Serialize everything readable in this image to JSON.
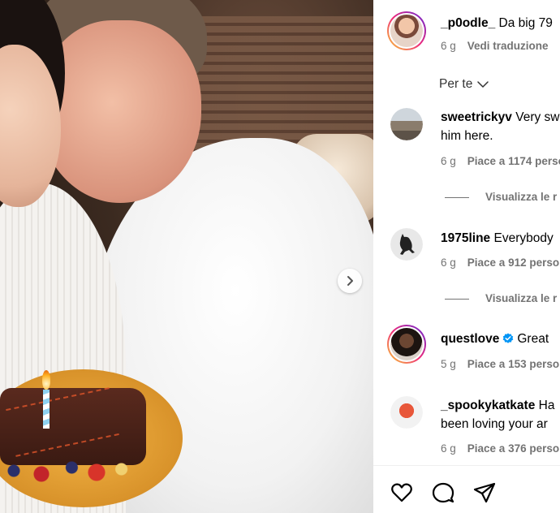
{
  "post": {
    "author": "_p0odle_",
    "caption": "Da big 79",
    "time": "6 g",
    "translate": "Vedi traduzione"
  },
  "filter": {
    "label": "Per te"
  },
  "comments": [
    {
      "user": "sweetrickyv",
      "text_line1": "Very sw",
      "text_line2": "him here.",
      "time": "6 g",
      "likes": "Piace a 1174 perso",
      "replies": "Visualizza le r"
    },
    {
      "user": "1975line",
      "text_line1": "Everybody",
      "time": "6 g",
      "likes": "Piace a 912 perso",
      "replies": "Visualizza le r"
    },
    {
      "user": "questlove",
      "text_line1": "Great",
      "verified": true,
      "time": "5 g",
      "likes": "Piace a 153 perso"
    },
    {
      "user": "_spookykatkate",
      "text_line1": "Ha",
      "text_line2": "been loving your ar",
      "time": "6 g",
      "likes": "Piace a 376 perso"
    }
  ],
  "icons": {
    "next": "chevron-right-icon",
    "like": "heart-icon",
    "comment": "comment-icon",
    "share": "send-icon",
    "filter": "chevron-down-icon",
    "verified": "verified-badge-icon"
  },
  "colors": {
    "secondary_text": "#737373",
    "verified": "#0095f6",
    "ring_start": "#f9ce34",
    "ring_mid": "#ee2a7b",
    "ring_end": "#6228d7"
  }
}
